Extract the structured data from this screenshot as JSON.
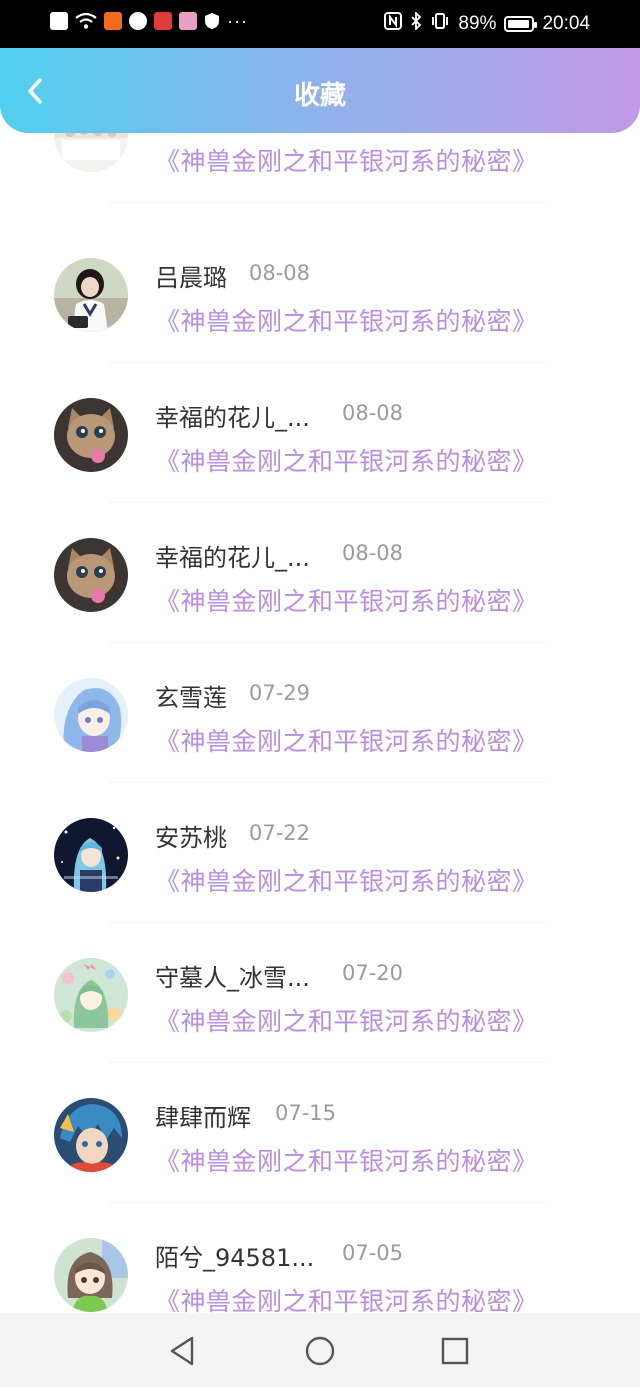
{
  "status_bar": {
    "battery_percent": "89%",
    "time": "20:04",
    "more_indicator": "···"
  },
  "header": {
    "title": "收藏",
    "back_icon": "chevron-left-icon",
    "gradient": [
      "#50d0ee",
      "#c199e6"
    ]
  },
  "colors": {
    "book_title": "#b98de0",
    "name": "#333333",
    "date": "#9b9b9b"
  },
  "items": [
    {
      "name": "",
      "date": "",
      "book": "《神兽金刚之和平银河系的秘密》",
      "avatar": "group-photo-avatar"
    },
    {
      "name": "吕晨璐",
      "date": "08-08",
      "book": "《神兽金刚之和平银河系的秘密》",
      "avatar": "girl-photo-avatar"
    },
    {
      "name": "幸福的花儿_...",
      "date": "08-08",
      "book": "《神兽金刚之和平银河系的秘密》",
      "avatar": "kitten-avatar"
    },
    {
      "name": "幸福的花儿_...",
      "date": "08-08",
      "book": "《神兽金刚之和平银河系的秘密》",
      "avatar": "kitten-avatar"
    },
    {
      "name": "玄雪莲",
      "date": "07-29",
      "book": "《神兽金刚之和平银河系的秘密》",
      "avatar": "anime-girl-avatar"
    },
    {
      "name": "安苏桃",
      "date": "07-22",
      "book": "《神兽金刚之和平银河系的秘密》",
      "avatar": "anime-night-avatar"
    },
    {
      "name": "守墓人_冰雪...",
      "date": "07-20",
      "book": "《神兽金刚之和平银河系的秘密》",
      "avatar": "anime-green-avatar"
    },
    {
      "name": "肆肆而辉",
      "date": "07-15",
      "book": "《神兽金刚之和平银河系的秘密》",
      "avatar": "anime-boy-avatar"
    },
    {
      "name": "陌兮_94581...",
      "date": "07-05",
      "book": "《神兽金刚之和平银河系的秘密》",
      "avatar": "anime-cap-avatar"
    }
  ]
}
